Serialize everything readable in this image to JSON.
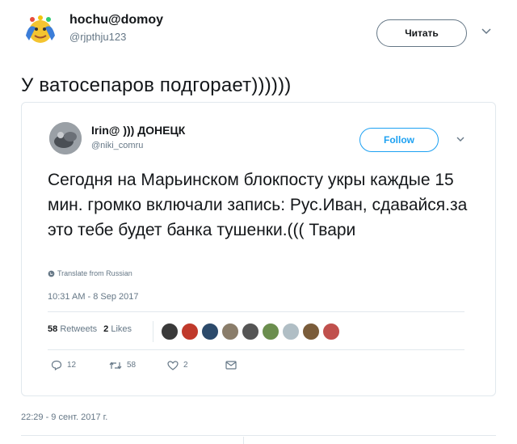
{
  "tweet": {
    "user_name": "hochu@domoy",
    "user_handle": "@rjpthju123",
    "follow_label": "Читать",
    "text": "У ватосепаров подгорает))))))",
    "timestamp": "22:29 - 9 сент. 2017 г."
  },
  "quoted": {
    "user_name": "Irin@ ))) ДОНЕЦК",
    "user_handle": "@niki_comru",
    "follow_label": "Follow",
    "text": "Сегодня на Марьинском блокпосту укры каждые 15 мин. громко включали запись: Рус.Иван, сдавайся.за это тебе будет банка тушенки.((( Твари",
    "translate_label": "Translate from Russian",
    "timestamp": "10:31 AM - 8 Sep 2017",
    "retweets_count": "58",
    "retweets_label": "Retweets",
    "likes_count": "2",
    "likes_label": "Likes",
    "reply_count": "12",
    "retweet_count": "58",
    "like_count": "2",
    "liker_colors": [
      "#3a3a3a",
      "#c0392b",
      "#2c4a6b",
      "#8a7d6a",
      "#555555",
      "#6b8e4e",
      "#b0bec5",
      "#7a5c3a",
      "#c0504d"
    ]
  },
  "colors": {
    "accent": "#1da1f2",
    "muted": "#657786",
    "border": "#e1e8ed",
    "text": "#14171a"
  }
}
